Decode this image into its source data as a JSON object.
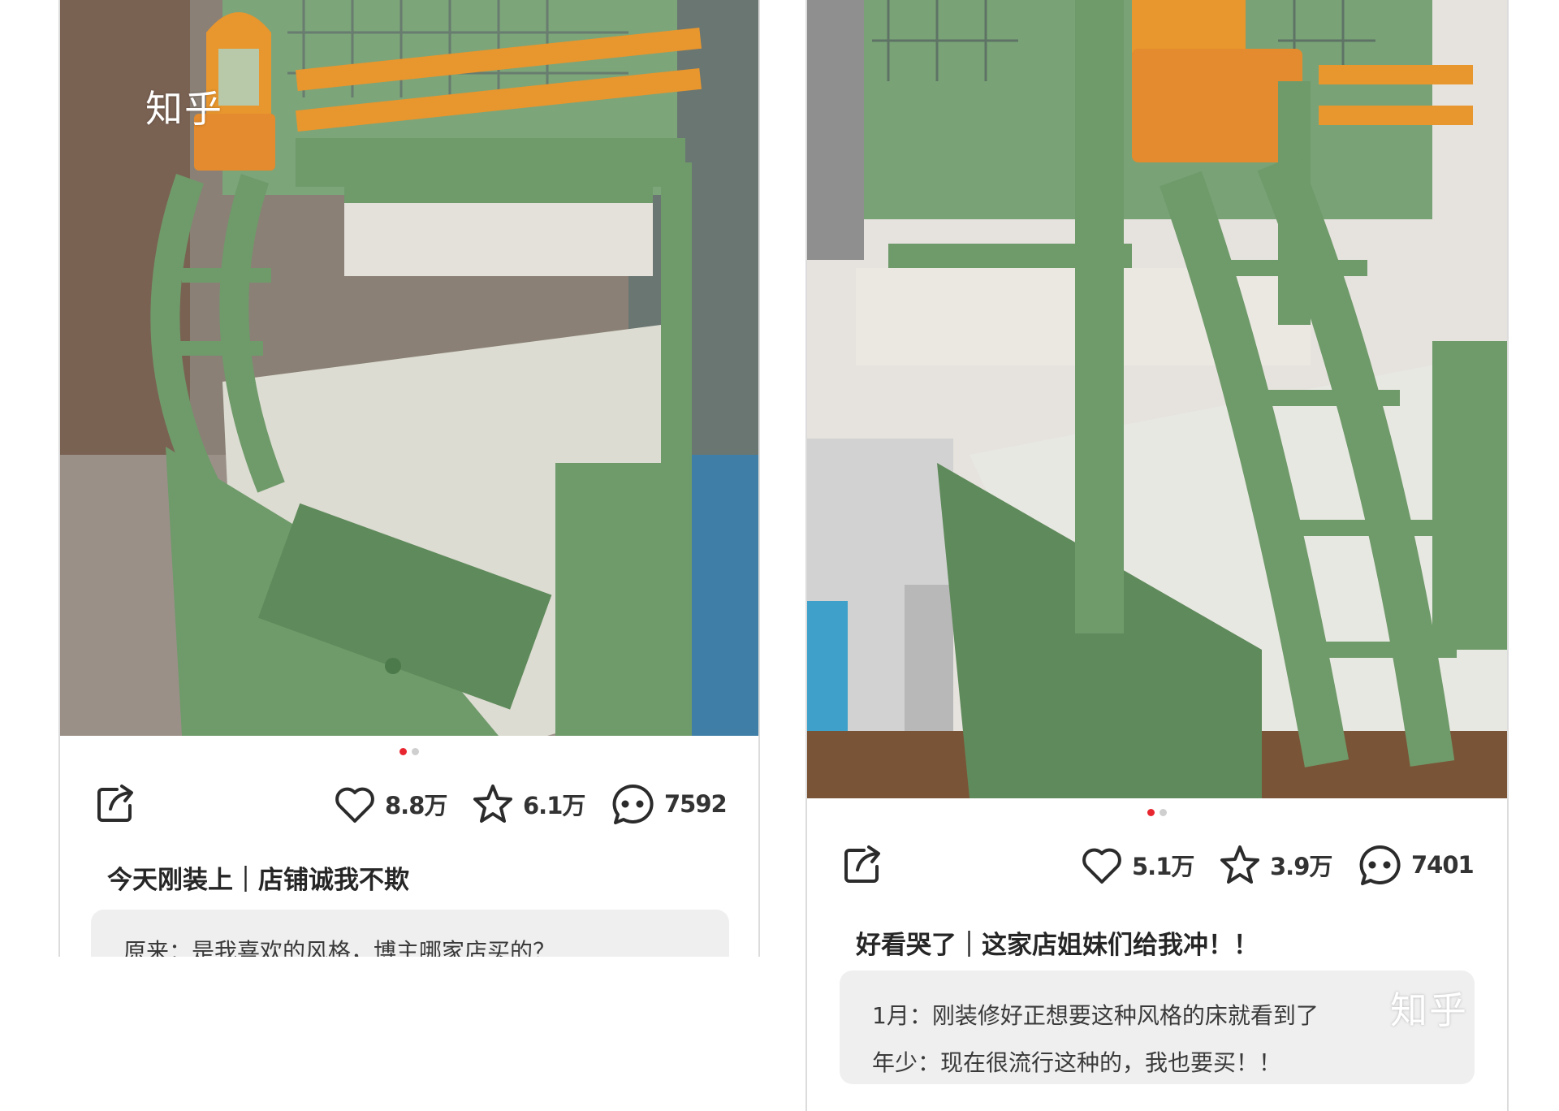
{
  "watermark": "知乎",
  "posts": [
    {
      "stats": {
        "likes": "8.8万",
        "favorites": "6.1万",
        "comments": "7592"
      },
      "title": "今天刚装上｜店铺诚我不欺",
      "comments": [
        "原来：是我喜欢的风格，博主哪家店买的？"
      ]
    },
    {
      "stats": {
        "likes": "5.1万",
        "favorites": "3.9万",
        "comments": "7401"
      },
      "title": "好看哭了｜这家店姐妹们给我冲！！",
      "comments": [
        "1月：刚装修好正想要这种风格的床就看到了",
        "年少：现在很流行这种的，我也要买！！"
      ]
    }
  ],
  "icons": {
    "share": "share-icon",
    "like": "heart-icon",
    "favorite": "star-icon",
    "comment": "comment-bubble-icon"
  },
  "colors": {
    "bed_green": "#6f9a6a",
    "accent_orange": "#e8962e",
    "active_dot": "#e8262f",
    "comment_bg": "#efefef"
  }
}
